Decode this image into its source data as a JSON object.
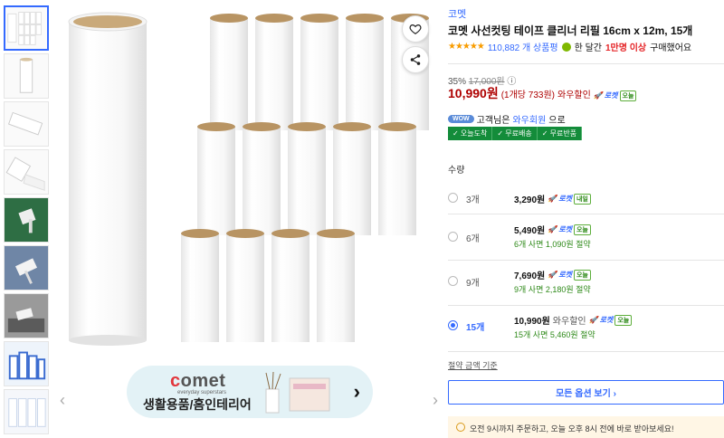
{
  "thumbnails": [
    {
      "name": "thumb-all-rolls"
    },
    {
      "name": "thumb-single-roll"
    },
    {
      "name": "thumb-roll-side"
    },
    {
      "name": "thumb-peeled-sheet"
    },
    {
      "name": "thumb-green-fabric"
    },
    {
      "name": "thumb-fabric-cleaning"
    },
    {
      "name": "thumb-sofa-cleaning"
    },
    {
      "name": "thumb-blue-pack"
    },
    {
      "name": "thumb-rolls-row"
    }
  ],
  "banner": {
    "brand": "comet",
    "tagline": "everyday superstars",
    "category": "생활용품/홈인테리어"
  },
  "product": {
    "brand": "코멧",
    "title": "코멧 사선컷팅 테이프 클리너 리필 16cm x 12m, 15개",
    "stars": "★★★★★",
    "review_count": "110,882 개 상품평",
    "buy_prefix": "한 달간",
    "buy_count": "1만명 이상",
    "buy_suffix": "구매했어요",
    "discount_rate": "35%",
    "original_price": "17,000원",
    "info_icon": "ⓘ",
    "price": "10,990원",
    "unit_price": "(1개당 733원)",
    "wow_sale": "와우할인",
    "rocket": "로켓",
    "rocket_day": "오늘",
    "wow_badge": "WOW",
    "wow_text_prefix": "고객님은",
    "wow_member": "와우회원",
    "wow_text_suffix": "으로",
    "benefits": [
      "✓ 오늘도착",
      "✓ 무료배송",
      "✓ 무료반품"
    ],
    "qty_label": "수량"
  },
  "options": [
    {
      "name": "3개",
      "price": "3,290원",
      "pre": "",
      "day": "내일",
      "save": "",
      "selected": false
    },
    {
      "name": "6개",
      "price": "5,490원",
      "pre": "",
      "day": "오늘",
      "save": "6개 사면 1,090원 절약",
      "selected": false
    },
    {
      "name": "9개",
      "price": "7,690원",
      "pre": "",
      "day": "오늘",
      "save": "9개 사면 2,180원 절약",
      "selected": false
    },
    {
      "name": "15개",
      "price": "10,990원",
      "pre": "와우할인",
      "day": "오늘",
      "save": "15개 사면 5,460원 절약",
      "selected": true
    }
  ],
  "criteria": "절약 금액 기준",
  "all_options": "모든 옵션 보기 ›",
  "delivery": "오전 9시까지 주문하고, 오늘 오후 8시 전에 바로 받아보세요!",
  "colors": {
    "accent": "#346aff",
    "price": "#ae0000",
    "green": "#138c3a",
    "star": "#f89c00"
  }
}
